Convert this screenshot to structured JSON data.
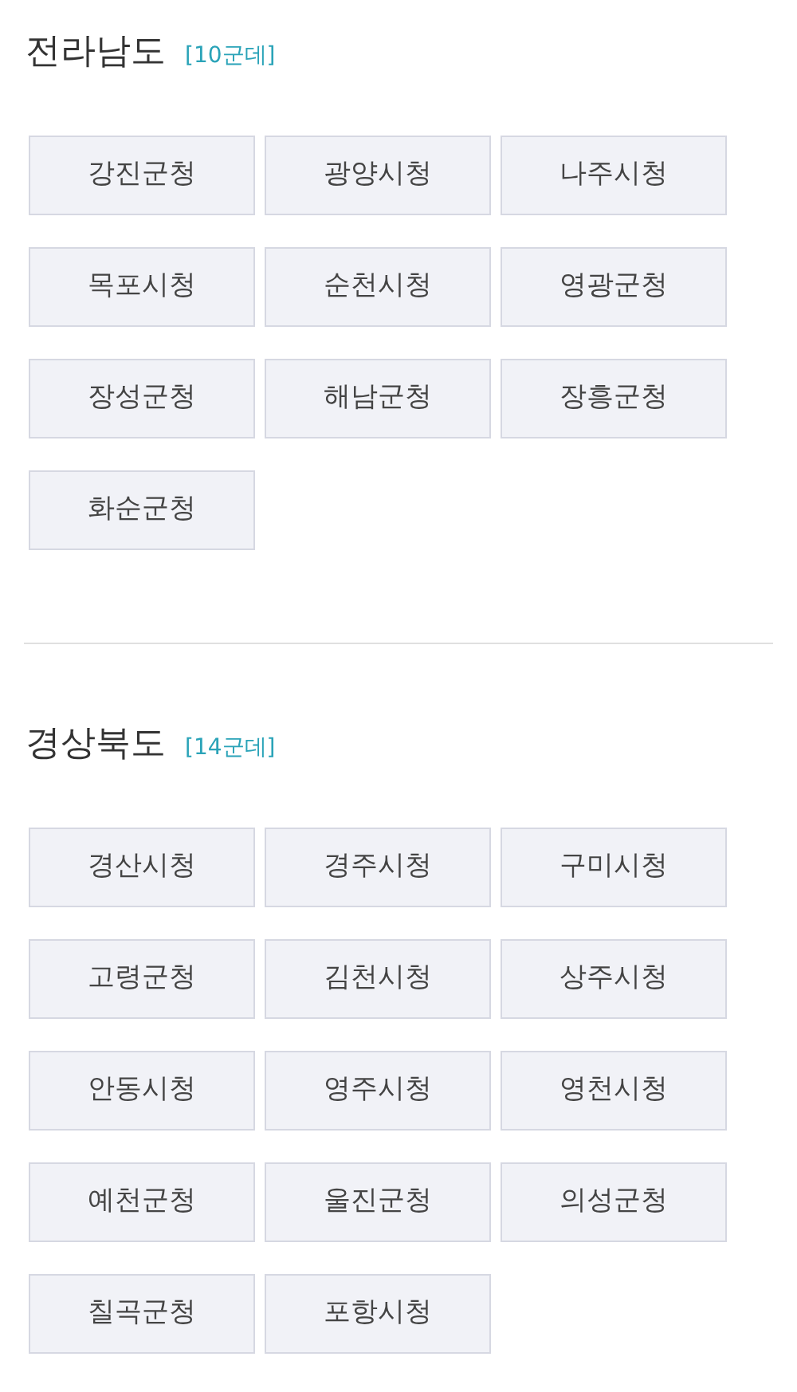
{
  "regions": [
    {
      "name": "전라남도",
      "count": "[10군데]",
      "offices": [
        "강진군청",
        "광양시청",
        "나주시청",
        "목포시청",
        "순천시청",
        "영광군청",
        "장성군청",
        "해남군청",
        "장흥군청",
        "화순군청"
      ]
    },
    {
      "name": "경상북도",
      "count": "[14군데]",
      "offices": [
        "경산시청",
        "경주시청",
        "구미시청",
        "고령군청",
        "김천시청",
        "상주시청",
        "안동시청",
        "영주시청",
        "영천시청",
        "예천군청",
        "울진군청",
        "의성군청",
        "칠곡군청",
        "포항시청"
      ]
    }
  ]
}
